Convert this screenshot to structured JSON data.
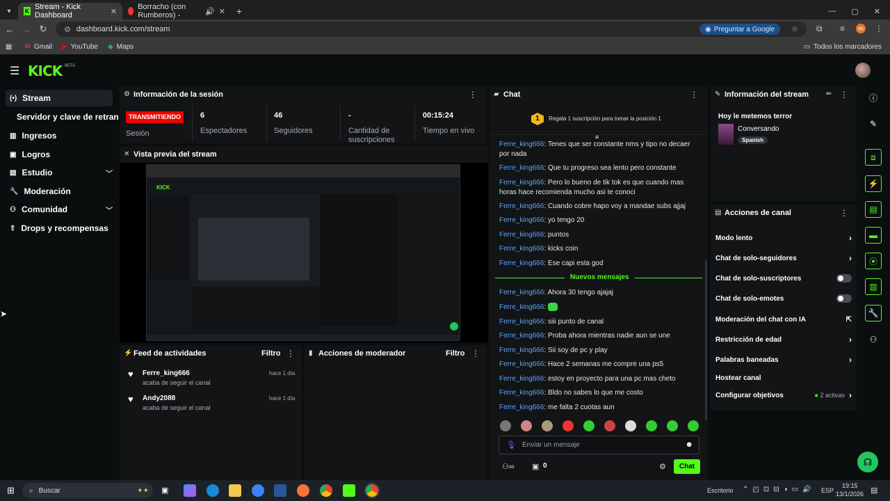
{
  "browser": {
    "tabs": [
      {
        "label": "Stream - Kick Dashboard",
        "active": true
      },
      {
        "label": "Borracho (con Rumberos) -",
        "active": false
      }
    ],
    "url": "dashboard.kick.com/stream",
    "ask_google": "Preguntar a Google",
    "bookmarks": [
      "Gmail",
      "YouTube",
      "Maps"
    ],
    "all_bookmarks": "Todos los marcadores",
    "profile_initial": "m"
  },
  "kick": {
    "logo": "KICK",
    "logo_badge": "BETA"
  },
  "sidebar": {
    "items": [
      {
        "label": "Stream",
        "icon": "broadcast-icon"
      },
      {
        "label": "Servidor y clave de retransm",
        "icon": ""
      },
      {
        "label": "Ingresos",
        "icon": "money-icon"
      },
      {
        "label": "Logros",
        "icon": "trophy-icon"
      },
      {
        "label": "Estudio",
        "icon": "studio-icon"
      },
      {
        "label": "Moderación",
        "icon": "wrench-icon"
      },
      {
        "label": "Comunidad",
        "icon": "community-icon"
      },
      {
        "label": "Drops y recompensas",
        "icon": "drops-icon"
      }
    ]
  },
  "session": {
    "title": "Información de la sesión",
    "status_badge": "TRANSMITIENDO",
    "status_label": "Sesión",
    "stats": [
      {
        "value": "6",
        "label": "Espectadores"
      },
      {
        "value": "46",
        "label": "Seguidores"
      },
      {
        "value": "-",
        "label": "Cantidad de suscripciones"
      },
      {
        "value": "00:15:24",
        "label": "Tiempo en vivo"
      }
    ]
  },
  "preview": {
    "title": "Vista previa del stream"
  },
  "activity": {
    "title": "Feed de actividades",
    "filter": "Filtro",
    "items": [
      {
        "user": "Ferre_king666",
        "action": "acaba de seguir el canal",
        "time": "hace 1 día"
      },
      {
        "user": "Andy2088",
        "action": "acaba de seguir el canal",
        "time": "hace 1 día"
      }
    ]
  },
  "mod_actions": {
    "title": "Acciones de moderador",
    "filter": "Filtro"
  },
  "chat": {
    "title": "Chat",
    "promo": "Regala 1 suscripción para tomar la posición 1",
    "promo_rank": "1",
    "messages_before": [
      {
        "user": "Ferre_king666",
        "text": "Tenes que ser constante nms y tipo no decaer por nada"
      },
      {
        "user": "Ferre_king666",
        "text": "Que tu progreso sea lento pero constante"
      },
      {
        "user": "Ferre_king666",
        "text": "Pero lo bueno de tik tok es que cuando mas horas hace recomienda mucho asi te conoci"
      },
      {
        "user": "Ferre_king666",
        "text": "Cuando cobre hapo voy a mandae subs ajjaj"
      },
      {
        "user": "Ferre_king666",
        "text": "yo tengo 20"
      },
      {
        "user": "Ferre_king666",
        "text": "puntos"
      },
      {
        "user": "Ferre_king666",
        "text": "kicks coin"
      },
      {
        "user": "Ferre_king666",
        "text": "Ese capi esta god"
      }
    ],
    "new_messages": "Nuevos mensajes",
    "messages_after": [
      {
        "user": "Ferre_king666",
        "text": "Ahora 30 tengo ajajaj"
      },
      {
        "user": "Ferre_king666",
        "text": ""
      },
      {
        "user": "Ferre_king666",
        "text": "siii punto de canal"
      },
      {
        "user": "Ferre_king666",
        "text": "Proba ahora mientras nadie aun se une"
      },
      {
        "user": "Ferre_king666",
        "text": "Sii soy de pc y play"
      },
      {
        "user": "Ferre_king666",
        "text": "Hace 2 semanas me compre una ps5"
      },
      {
        "user": "Ferre_king666",
        "text": "estoy en proyecto para una pc mas cheto"
      },
      {
        "user": "Ferre_king666",
        "text": "Bldo no sabes lo que me costo"
      },
      {
        "user": "Ferre_king666",
        "text": "me falta 2 cuotas aun"
      }
    ],
    "input_placeholder": "Enviar un mensaje",
    "points": "0",
    "send_label": "Chat",
    "emote_colors": [
      "#777",
      "#c88",
      "#a97",
      "#e33",
      "#3c3",
      "#c44",
      "#ddd",
      "#3c3",
      "#3c3",
      "#3c3"
    ]
  },
  "stream_info": {
    "title": "Información del stream",
    "stream_title": "Hoy le metemos terror",
    "category": "Conversando",
    "language": "Spanish"
  },
  "channel_actions": {
    "title": "Acciones de canal",
    "items": [
      {
        "label": "Modo lento",
        "control": "arrow"
      },
      {
        "label": "Chat de solo-seguidores",
        "control": "arrow"
      },
      {
        "label": "Chat de solo-suscriptores",
        "control": "toggle"
      },
      {
        "label": "Chat de solo-emotes",
        "control": "toggle"
      },
      {
        "label": "Moderación del chat con IA",
        "control": "external"
      },
      {
        "label": "Restricción de edad",
        "control": "arrow"
      },
      {
        "label": "Palabras baneadas",
        "control": "arrow"
      },
      {
        "label": "Hostear canal",
        "control": "none"
      },
      {
        "label": "Configurar objetivos",
        "control": "arrow",
        "extra": "2 activas"
      }
    ]
  },
  "taskbar": {
    "search": "Buscar",
    "desktop_label": "Escritorio",
    "lang": "ESP",
    "time": "19:15",
    "date": "13/1/2026"
  },
  "colors": {
    "kick_green": "#53fc18",
    "live_red": "#eb0400",
    "chat_user": "#5da4ff"
  }
}
